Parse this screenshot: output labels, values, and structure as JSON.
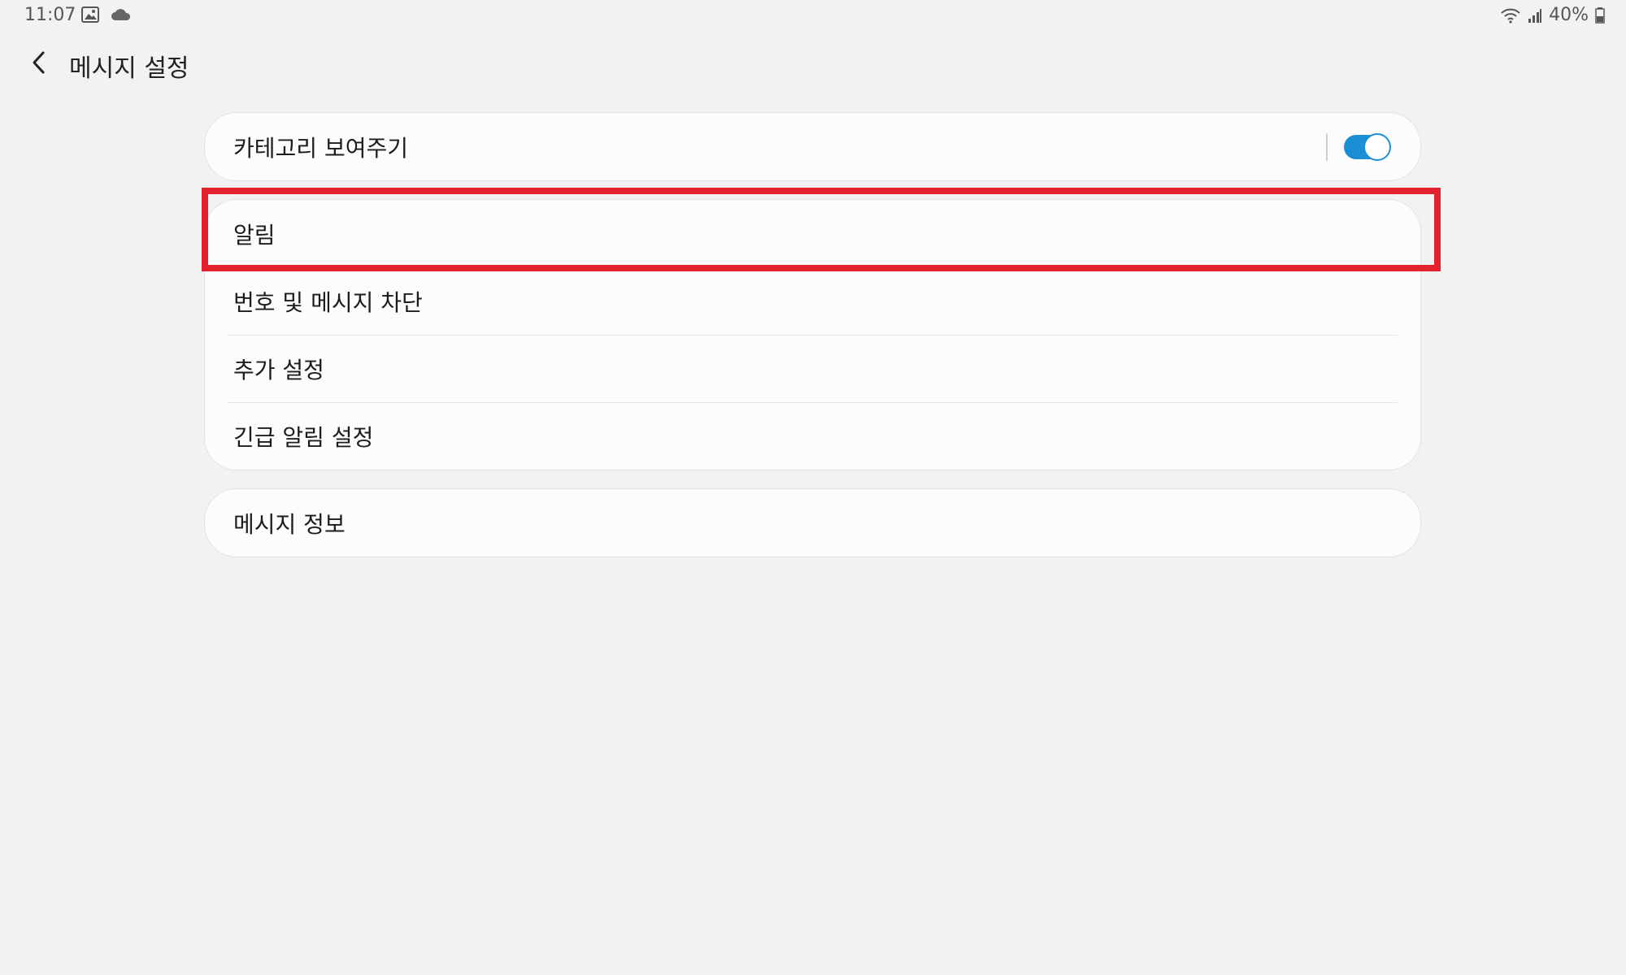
{
  "status_bar": {
    "time": "11:07",
    "left_icons": [
      "gallery-icon",
      "cloud-icon"
    ],
    "right_icons": [
      "wifi-icon",
      "signal-icon",
      "battery-icon"
    ],
    "battery_percent": "40%"
  },
  "header": {
    "back_icon": "chevron-left-icon",
    "title": "메시지 설정"
  },
  "cards": {
    "category_card": {
      "label": "카테고리 보여주기",
      "toggle_on": true
    },
    "settings_card": {
      "items": [
        {
          "label": "알림"
        },
        {
          "label": "번호 및 메시지 차단"
        },
        {
          "label": "추가 설정"
        },
        {
          "label": "긴급 알림 설정"
        }
      ]
    },
    "info_card": {
      "label": "메시지 정보"
    }
  },
  "colors": {
    "background": "#f2f2f2",
    "card": "#fcfcfc",
    "toggle_on": "#1a8fd6",
    "highlight": "#e3222d"
  }
}
